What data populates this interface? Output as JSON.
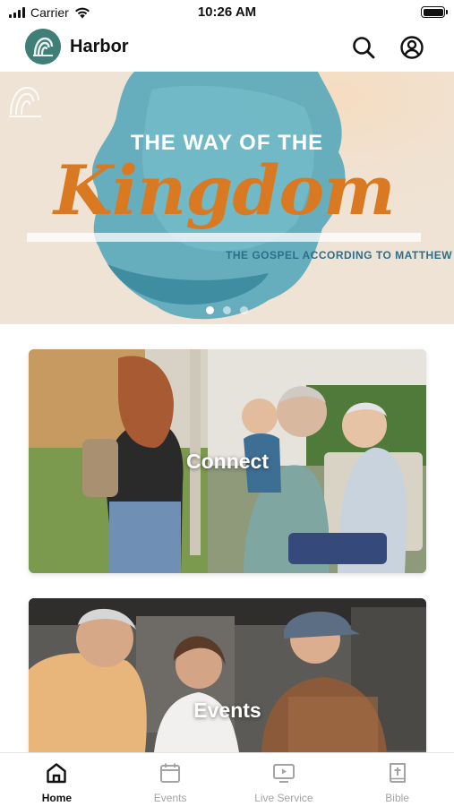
{
  "status": {
    "carrier": "Carrier",
    "time": "10:26 AM"
  },
  "header": {
    "title": "Harbor",
    "icons": [
      "search-icon",
      "account-icon"
    ]
  },
  "hero": {
    "line1": "THE WAY OF THE",
    "line2": "Kingdom",
    "line3": "THE GOSPEL ACCORDING TO MATTHEW",
    "slide_count": 3,
    "active_slide": 1
  },
  "cards": [
    {
      "label": "Connect"
    },
    {
      "label": "Events"
    }
  ],
  "tabs": [
    {
      "label": "Home",
      "icon": "home-icon",
      "active": true
    },
    {
      "label": "Events",
      "icon": "calendar-icon",
      "active": false
    },
    {
      "label": "Live Service",
      "icon": "tv-play-icon",
      "active": false
    },
    {
      "label": "Bible",
      "icon": "bible-icon",
      "active": false
    }
  ],
  "colors": {
    "brand": "#3f7f78",
    "hero_script": "#d97a22",
    "hero_subtitle": "#2d6f8a",
    "tab_active": "#111111",
    "tab_inactive": "#a3a3a3"
  }
}
